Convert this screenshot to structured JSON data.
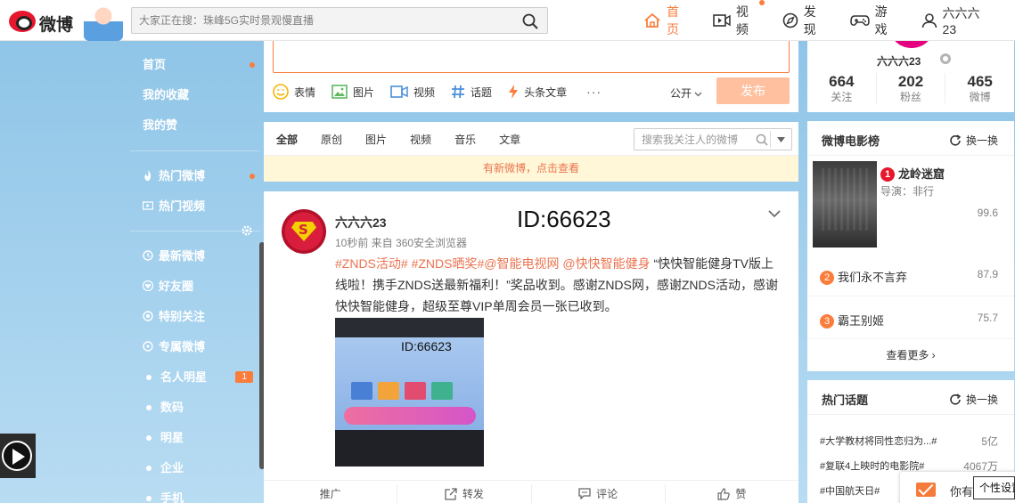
{
  "header": {
    "logo_text": "微博",
    "search_placeholder": "大家正在搜：珠峰5G实时景观慢直播",
    "nav": [
      {
        "label": "首页",
        "icon": "home-icon",
        "active": true
      },
      {
        "label": "视频",
        "icon": "video-icon",
        "badge_dot": true
      },
      {
        "label": "发现",
        "icon": "compass-icon"
      },
      {
        "label": "游戏",
        "icon": "gamepad-icon"
      },
      {
        "label": "六六六23",
        "icon": "user-icon"
      }
    ]
  },
  "sidebar": {
    "top_items": [
      {
        "label": "首页",
        "dot": true
      },
      {
        "label": "我的收藏"
      },
      {
        "label": "我的赞"
      }
    ],
    "mid_items": [
      {
        "label": "热门微博",
        "icon": "fire-icon",
        "dot": true
      },
      {
        "label": "热门视频",
        "icon": "video-icon"
      }
    ],
    "group_items": [
      {
        "label": "最新微博",
        "icon": "clock-icon"
      },
      {
        "label": "好友圈",
        "icon": "heart-icon"
      },
      {
        "label": "特别关注",
        "icon": "target-icon"
      },
      {
        "label": "专属微博",
        "icon": "tag-icon"
      }
    ],
    "category_items": [
      {
        "label": "名人明星",
        "count": "1"
      },
      {
        "label": "数码"
      },
      {
        "label": "明星"
      },
      {
        "label": "企业"
      },
      {
        "label": "手机"
      }
    ]
  },
  "publisher": {
    "tools": [
      {
        "label": "表情",
        "icon": "emoji-icon",
        "color": "#f7b500"
      },
      {
        "label": "图片",
        "icon": "image-icon",
        "color": "#5fb760"
      },
      {
        "label": "视频",
        "icon": "video-icon",
        "color": "#4a8fd9"
      },
      {
        "label": "话题",
        "icon": "hashtag-icon",
        "color": "#4a8fd9"
      },
      {
        "label": "头条文章",
        "icon": "lightning-icon",
        "color": "#fa7d3c"
      }
    ],
    "more_label": "···",
    "visibility_label": "公开",
    "post_button": "发布"
  },
  "feed_tabs": [
    "全部",
    "原创",
    "图片",
    "视频",
    "音乐",
    "文章"
  ],
  "feed_search_placeholder": "搜索我关注人的微博",
  "new_notice": "有新微博，点击查看",
  "post": {
    "username": "六六六23",
    "meta": "10秒前 来自 360安全浏览器",
    "id_overlay": "ID:66623",
    "text_link": "#ZNDS活动# #ZNDS晒奖#@智能电视网 @快快智能健身",
    "text_body": " “快快智能健身TV版上线啦！携手ZNDS送最新福利！”奖品收到。感谢ZNDS网，感谢ZNDS活动，感谢快快智能健身，超级至尊VIP单周会员一张已收到。",
    "image_id": "ID:66623",
    "actions": [
      {
        "label": "推广",
        "icon": ""
      },
      {
        "label": "转发",
        "icon": "share-icon"
      },
      {
        "label": "评论",
        "icon": "comment-icon"
      },
      {
        "label": "赞",
        "icon": "thumbs-up-icon"
      }
    ]
  },
  "profile": {
    "name": "六六六23",
    "stats": [
      {
        "value": "664",
        "label": "关注"
      },
      {
        "value": "202",
        "label": "粉丝"
      },
      {
        "value": "465",
        "label": "微博"
      }
    ]
  },
  "movie_board": {
    "title": "微博电影榜",
    "refresh_label": "换一换",
    "items": [
      {
        "rank": "1",
        "title": "龙岭迷窟",
        "director": "导演：非行",
        "score": "99.6",
        "color": "#e6162d"
      },
      {
        "rank": "2",
        "title": "我们永不言弃",
        "score": "87.9",
        "color": "#fa7d3c"
      },
      {
        "rank": "3",
        "title": "霸王别姬",
        "score": "75.7",
        "color": "#fa7d3c"
      }
    ],
    "see_more": "查看更多 ›"
  },
  "hot_topics": {
    "title": "热门话题",
    "refresh_label": "换一换",
    "items": [
      {
        "topic": "#大学教材将同性恋归为...#",
        "count": "5亿"
      },
      {
        "topic": "#复联4上映时的电影院#",
        "count": "4067万"
      },
      {
        "topic": "#中国航天日#",
        "count": ""
      }
    ]
  },
  "message_bar": {
    "label": "你有"
  },
  "tooltip": "个性设置"
}
